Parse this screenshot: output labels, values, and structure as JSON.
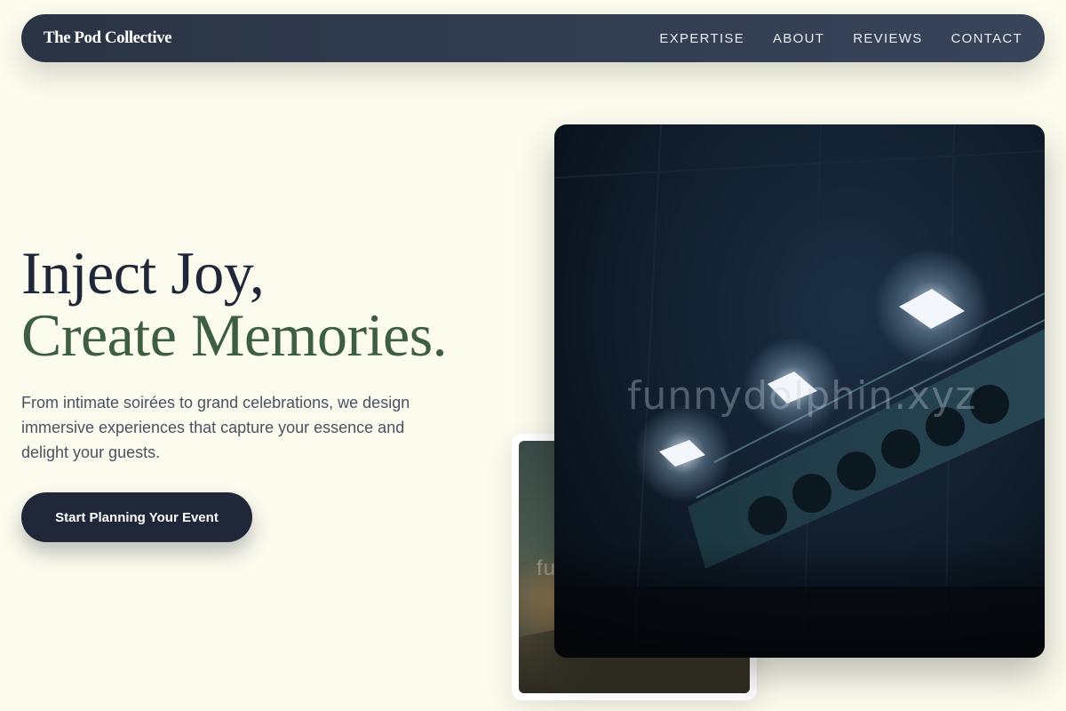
{
  "nav": {
    "brand": "The Pod Collective",
    "links": [
      {
        "label": "EXPERTISE"
      },
      {
        "label": "ABOUT"
      },
      {
        "label": "REVIEWS"
      },
      {
        "label": "CONTACT"
      }
    ]
  },
  "hero": {
    "title_line1": "Inject Joy,",
    "title_line2": "Create Memories.",
    "description": "From intimate soirées to grand celebrations, we design immersive experiences that capture your essence and delight your guests.",
    "cta_label": "Start Planning Your Event"
  },
  "images": {
    "large": {
      "watermark": "funnydolphin.xyz"
    },
    "small": {
      "watermark": "fu"
    }
  },
  "colors": {
    "background": "#fbfbee",
    "navbar": "#2a3444",
    "title_dark": "#1f2738",
    "title_green": "#3d5e40",
    "button": "#1f2738"
  }
}
